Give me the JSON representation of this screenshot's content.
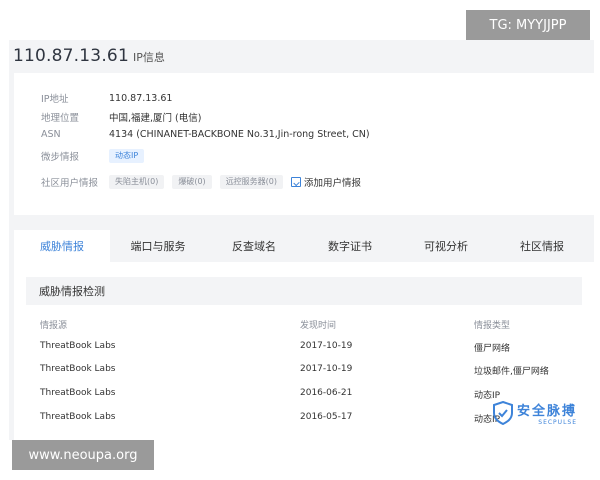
{
  "watermarks": {
    "tg": "TG: MYYJJPP",
    "site": "www.neoupa.org"
  },
  "header": {
    "ip": "110.87.13.61",
    "subtitle": "IP信息"
  },
  "info": {
    "ip_label": "IP地址",
    "ip_value": "110.87.13.61",
    "geo_label": "地理位置",
    "geo_value": "中国,福建,厦门 (电信)",
    "asn_label": "ASN",
    "asn_value": "4134  (CHINANET-BACKBONE No.31,Jin-rong Street, CN)",
    "intel_label": "微步情报",
    "intel_tag": "动态IP",
    "community_label": "社区用户情报",
    "community_tags": [
      "失陷主机(0)",
      "爆破(0)",
      "远控服务器(0)"
    ],
    "add_label": "添加用户情报"
  },
  "tabs": [
    "威胁情报",
    "端口与服务",
    "反查域名",
    "数字证书",
    "可视分析",
    "社区情报"
  ],
  "panel": {
    "title": "威胁情报检测",
    "columns": [
      "情报源",
      "发现时间",
      "情报类型"
    ],
    "rows": [
      [
        "ThreatBook Labs",
        "2017-10-19",
        "僵尸网络"
      ],
      [
        "ThreatBook Labs",
        "2017-10-19",
        "垃圾邮件,僵尸网络"
      ],
      [
        "ThreatBook Labs",
        "2016-06-21",
        "动态IP"
      ],
      [
        "ThreatBook Labs",
        "2016-05-17",
        "动态IP"
      ]
    ]
  },
  "logo": {
    "cn": "安全脉搏",
    "en": "SECPULSE"
  },
  "colors": {
    "accent": "#3d83d9",
    "bg": "#f3f4f6"
  }
}
